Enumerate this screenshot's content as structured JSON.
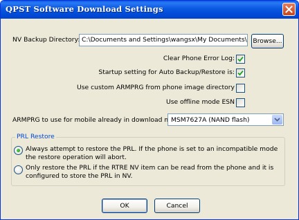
{
  "window": {
    "title": "QPST Software Download Settings",
    "close_icon": "close-icon"
  },
  "nv_backup": {
    "label": "NV Backup Directory:",
    "value": "C:\\Documents and Settings\\wangsx\\My Documents\\",
    "browse_label": "Browse..."
  },
  "options": [
    {
      "label": "Clear Phone Error Log:",
      "checked": true
    },
    {
      "label": "Startup setting for Auto Backup/Restore is:",
      "checked": true
    },
    {
      "label": "Use custom ARMPRG from phone image directory",
      "checked": false
    },
    {
      "label": "Use offline mode ESN",
      "checked": false
    }
  ],
  "armprg": {
    "label": "ARMPRG to use for mobile already in download mode",
    "selected": "MSM7627A (NAND flash)"
  },
  "prl": {
    "title": "PRL Restore",
    "options": [
      {
        "text": "Always attempt to restore the PRL.  If the phone is set to an incompatible mode the restore operation will abort.",
        "selected": true
      },
      {
        "text": "Only restore the PRL if the RTRE NV item can be read from the phone and it is configured to store the PRL in NV.",
        "selected": false
      }
    ]
  },
  "buttons": {
    "ok": "OK",
    "cancel": "Cancel"
  },
  "colors": {
    "titlebar": "#0a58e0",
    "face": "#ece9d8",
    "group_title": "#0046d5",
    "check": "#21a121"
  }
}
